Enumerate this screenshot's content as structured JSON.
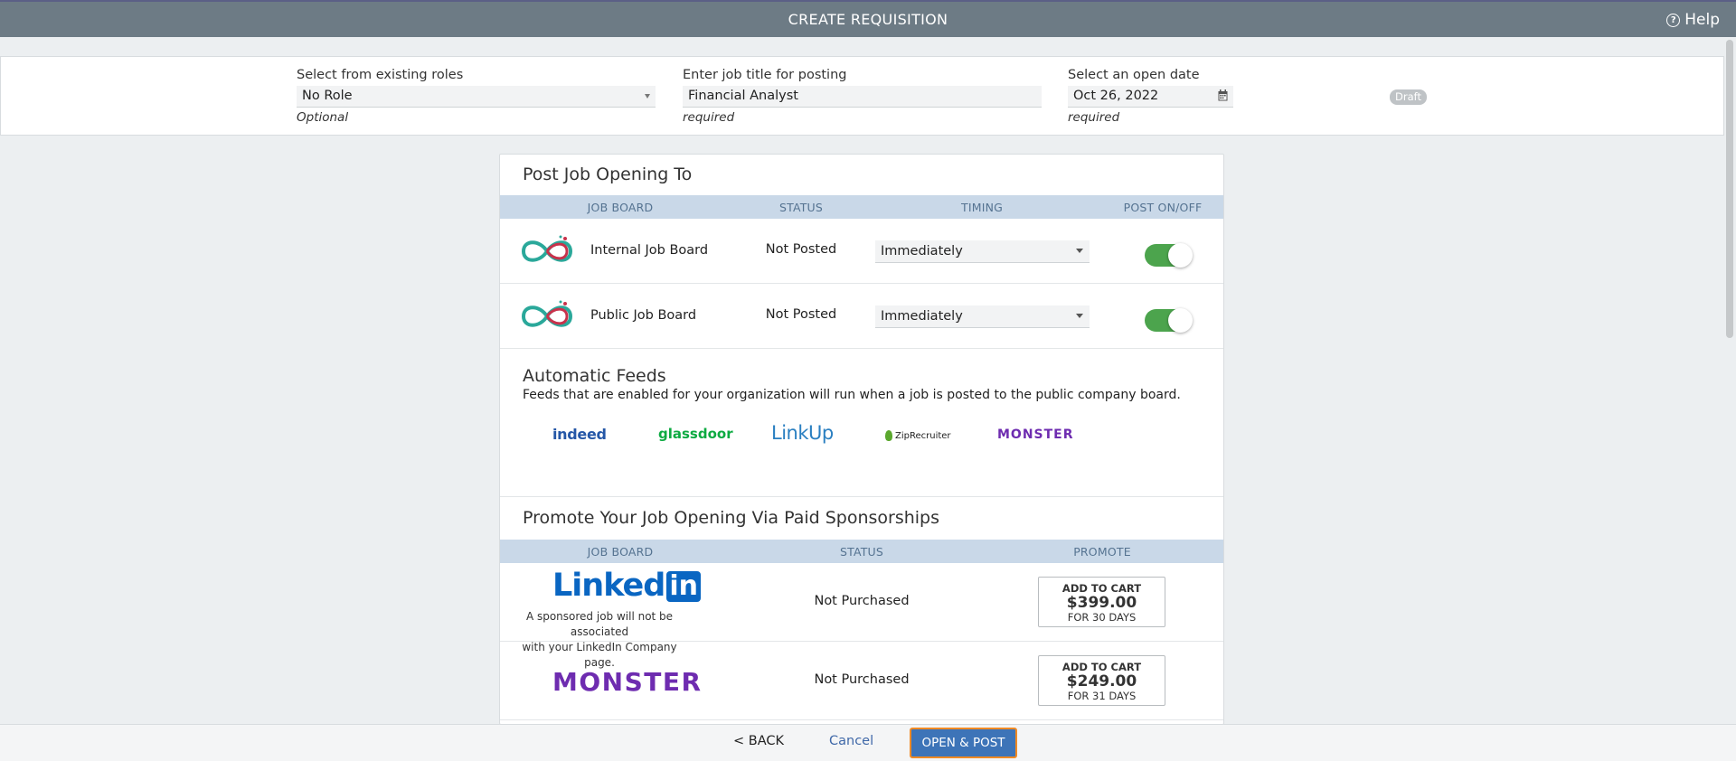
{
  "header": {
    "title": "CREATE REQUISITION",
    "help_label": "Help"
  },
  "form": {
    "role": {
      "label": "Select from existing roles",
      "value": "No Role",
      "note": "Optional"
    },
    "job_title": {
      "label": "Enter job title for posting",
      "value": "Financial Analyst",
      "note": "required"
    },
    "open_date": {
      "label": "Select an open date",
      "value": "Oct 26, 2022",
      "note": "required"
    },
    "status_badge": "Draft"
  },
  "post_section": {
    "title": "Post Job Opening To",
    "columns": [
      "JOB BOARD",
      "STATUS",
      "TIMING",
      "POST ON/OFF"
    ],
    "boards": [
      {
        "name": "Internal Job Board",
        "status": "Not Posted",
        "timing": "Immediately",
        "posted": true
      },
      {
        "name": "Public Job Board",
        "status": "Not Posted",
        "timing": "Immediately",
        "posted": true
      }
    ]
  },
  "feeds": {
    "title": "Automatic Feeds",
    "description": "Feeds that are enabled for your organization will run when a job is posted to the public company board.",
    "items": [
      "indeed",
      "glassdoor",
      "LinkUp",
      "ZipRecruiter",
      "MONSTER"
    ]
  },
  "promote_section": {
    "title": "Promote Your Job Opening Via Paid Sponsorships",
    "columns": [
      "JOB BOARD",
      "STATUS",
      "PROMOTE"
    ],
    "rows": [
      {
        "logo_text": "Linked",
        "logo_box": "in",
        "note_line1": "A sponsored job will not be associated",
        "note_line2": "with your LinkedIn Company page.",
        "status": "Not Purchased",
        "cart_label": "ADD TO CART",
        "price": "$399.00",
        "duration": "FOR 30 DAYS"
      },
      {
        "logo_text": "MONSTER",
        "status": "Not Purchased",
        "cart_label": "ADD TO CART",
        "price": "$249.00",
        "duration": "FOR 31 DAYS"
      }
    ]
  },
  "footer": {
    "back_label": "< BACK",
    "cancel_label": "Cancel",
    "open_post_label": "OPEN & POST"
  },
  "colors": {
    "topbar": "#6d7b85",
    "accent": "#3d74b8",
    "focus": "#f08a24",
    "toggle_on": "#4ca44d",
    "table_header": "#c9d8e8"
  }
}
